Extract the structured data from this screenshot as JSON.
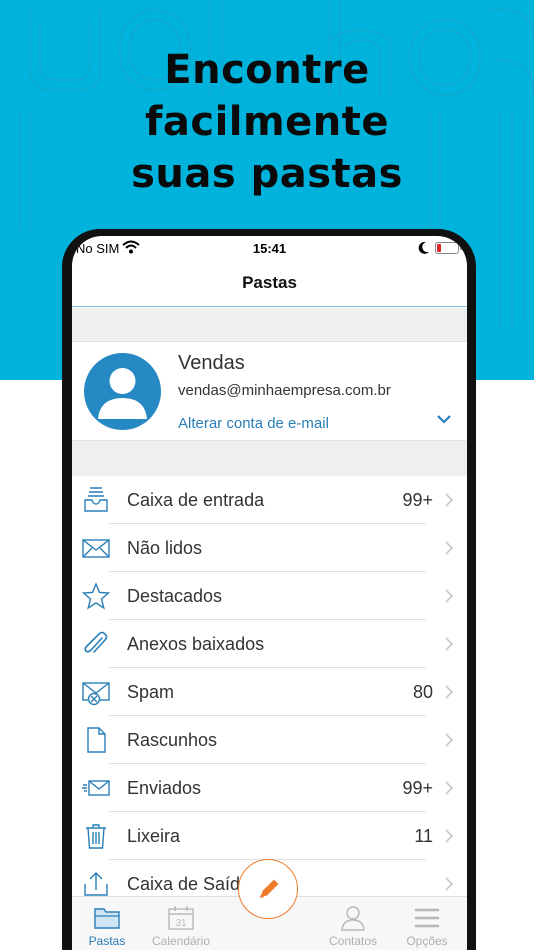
{
  "headline": {
    "line1": "Encontre",
    "line2": "facilmente",
    "line3": "suas pastas"
  },
  "status_bar": {
    "carrier": "No SIM",
    "time": "15:41",
    "battery_level": 0.2
  },
  "navbar": {
    "title": "Pastas"
  },
  "account": {
    "name": "Vendas",
    "email": "vendas@minhaempresa.com.br",
    "change_label": "Alterar conta de e-mail"
  },
  "folders": [
    {
      "label": "Caixa de entrada",
      "count": "99+",
      "icon": "inbox-icon"
    },
    {
      "label": "Não lidos",
      "count": "",
      "icon": "envelope-icon"
    },
    {
      "label": "Destacados",
      "count": "",
      "icon": "star-icon"
    },
    {
      "label": "Anexos baixados",
      "count": "",
      "icon": "paperclip-icon"
    },
    {
      "label": "Spam",
      "count": "80",
      "icon": "spam-icon"
    },
    {
      "label": "Rascunhos",
      "count": "",
      "icon": "document-icon"
    },
    {
      "label": "Enviados",
      "count": "99+",
      "icon": "sent-icon"
    },
    {
      "label": "Lixeira",
      "count": "11",
      "icon": "trash-icon"
    },
    {
      "label": "Caixa de Saída",
      "count": "",
      "icon": "outbox-icon"
    }
  ],
  "tabbar": {
    "pastas": "Pastas",
    "calendario": "Calendário",
    "calendar_day": "31",
    "contatos": "Contatos",
    "opcoes": "Opções"
  },
  "colors": {
    "brand_cyan": "#00b3dc",
    "accent_blue": "#2a7fb8",
    "compose_orange": "#f07b2a"
  }
}
